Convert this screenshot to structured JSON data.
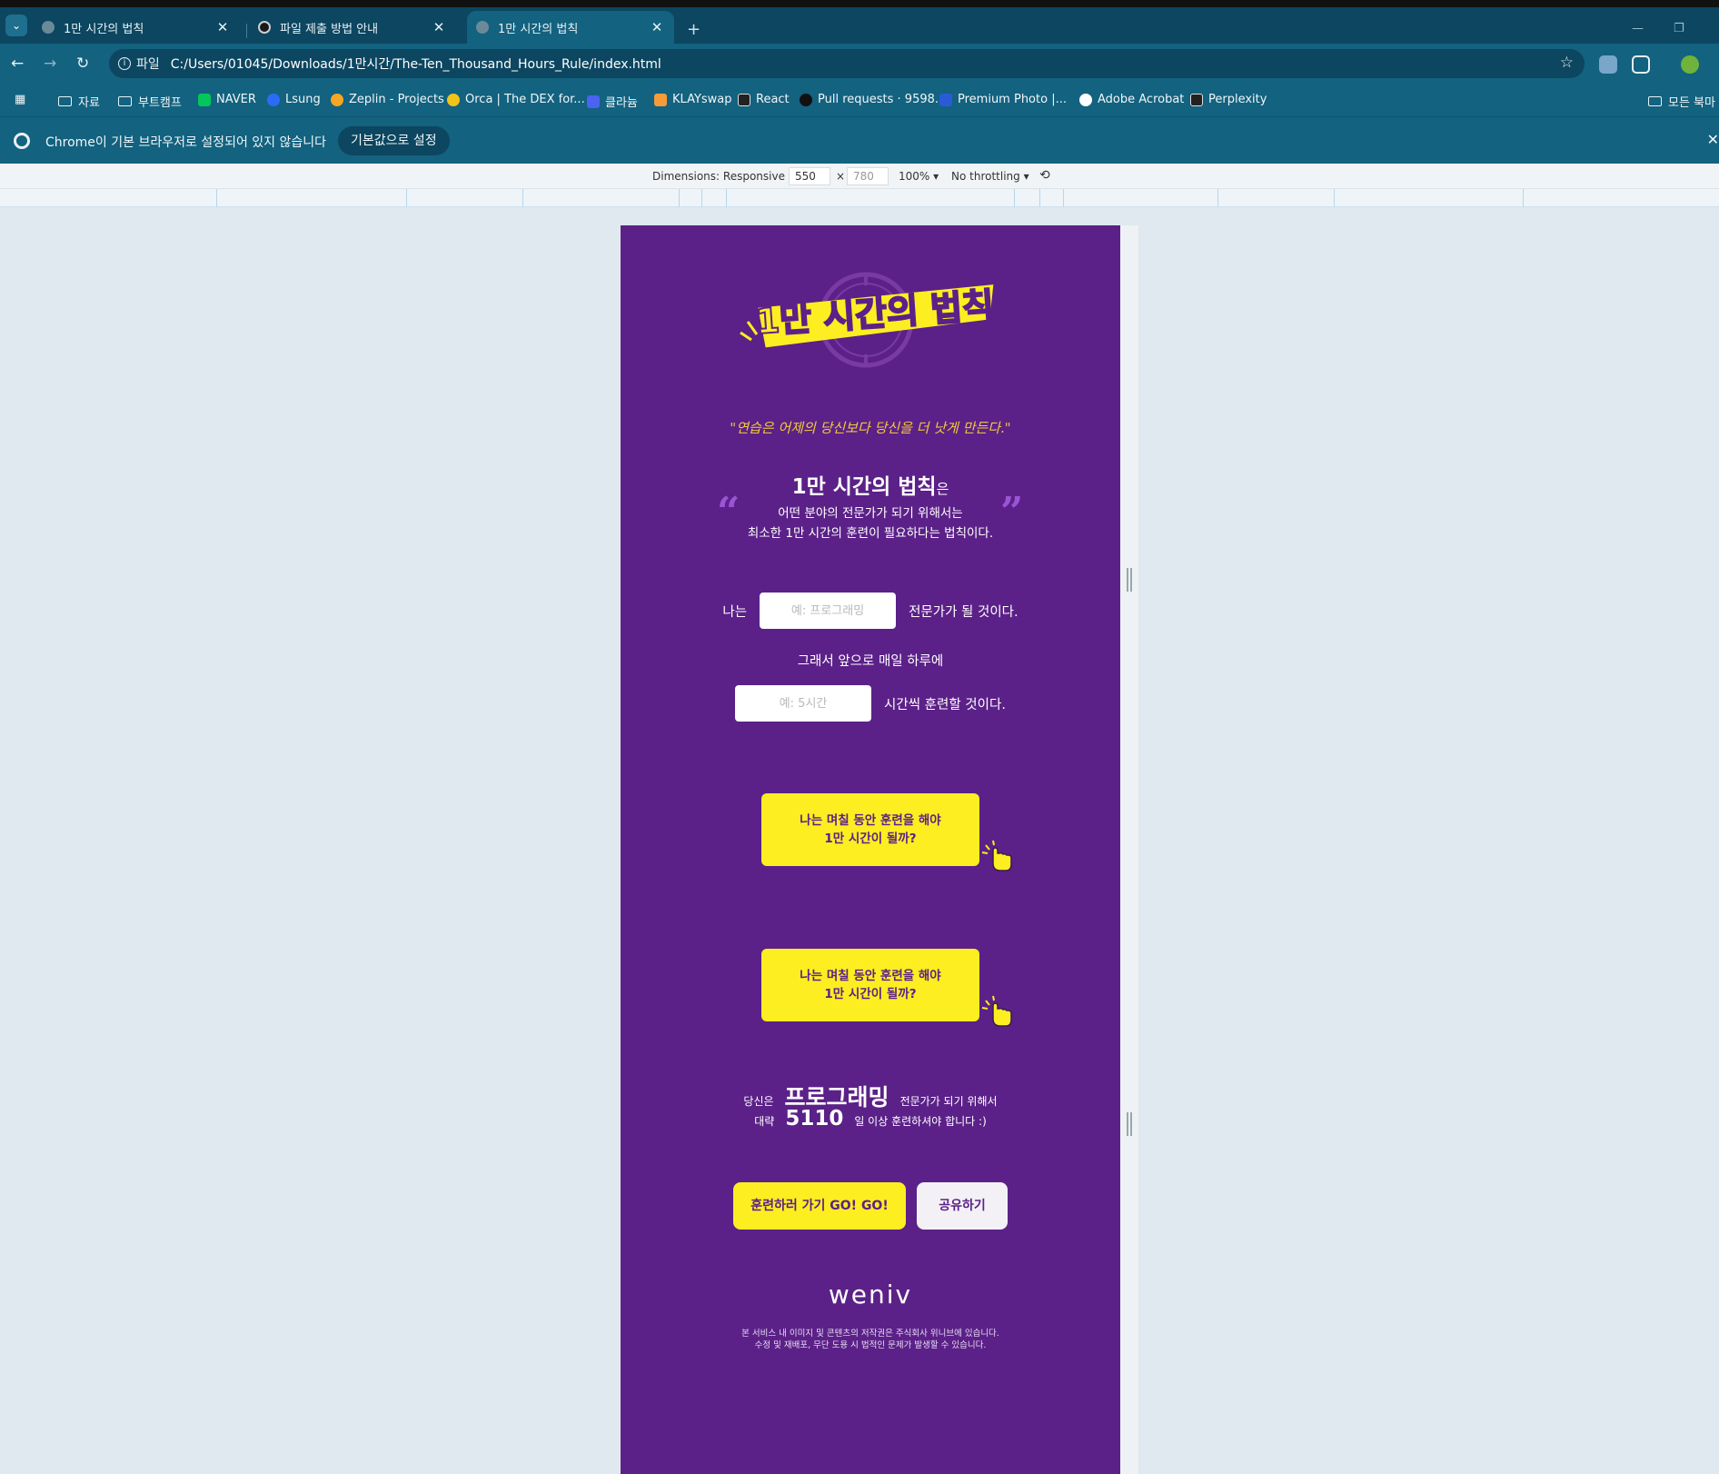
{
  "browser": {
    "tabs": [
      {
        "title": "1만 시간의 법칙",
        "active": false
      },
      {
        "title": "파일 제출 방법 안내",
        "active": false
      },
      {
        "title": "1만 시간의 법칙",
        "active": true
      }
    ],
    "address": {
      "scheme_chip": "파일",
      "url": "C:/Users/01045/Downloads/1만시간/The-Ten_Thousand_Hours_Rule/index.html"
    },
    "bookmarks": [
      {
        "label": "자료",
        "type": "folder"
      },
      {
        "label": "부트캠프",
        "type": "folder"
      },
      {
        "label": "NAVER",
        "type": "site",
        "color": "#03c75a"
      },
      {
        "label": "Lsung",
        "type": "site",
        "color": "#2b6cf6"
      },
      {
        "label": "Zeplin - Projects",
        "type": "site",
        "color": "#f6a623"
      },
      {
        "label": "Orca | The DEX for...",
        "type": "site",
        "color": "#f0c419"
      },
      {
        "label": "클라늄",
        "type": "site",
        "color": "#4a63f0"
      },
      {
        "label": "KLAYswap",
        "type": "site",
        "color": "#f59b3a"
      },
      {
        "label": "React",
        "type": "site",
        "color": "#222222"
      },
      {
        "label": "Pull requests · 9598...",
        "type": "site",
        "color": "#111111"
      },
      {
        "label": "Premium Photo |...",
        "type": "site",
        "color": "#2a5bd7"
      },
      {
        "label": "Adobe Acrobat",
        "type": "site",
        "color": "#ffffff"
      },
      {
        "label": "Perplexity",
        "type": "site",
        "color": "#222222"
      }
    ],
    "all_bookmarks": "모든 북마",
    "infobar": {
      "message": "Chrome이 기본 브라우저로 설정되어 있지 않습니다",
      "button": "기본값으로 설정"
    },
    "devtools": {
      "dimensions_label": "Dimensions: Responsive",
      "width": "550",
      "height_placeholder": "780",
      "times": "×",
      "zoom": "100%",
      "throttling": "No throttling"
    }
  },
  "page": {
    "quote": "\"연습은 어제의 당신보다 당신을 더 낫게 만든다.\"",
    "intro": {
      "title": "1만 시간의 법칙",
      "title_suffix": "은",
      "line1": "어떤 분야의 전문가가 되기 위해서는",
      "line2": "최소한 1만 시간의 훈련이 필요하다는 법칙이다."
    },
    "form": {
      "prefix": "나는",
      "field_placeholder": "예: 프로그래밍",
      "field_suffix": "전문가가 될 것이다.",
      "middle": "그래서 앞으로 매일 하루에",
      "time_placeholder": "예: 5시간",
      "time_suffix": "시간씩 훈련할 것이다."
    },
    "cta_label": "나는 며칠 동안 훈련을 해야\n1만 시간이 될까?",
    "result": {
      "you": "당신은",
      "field": "프로그래밍",
      "field_tail": "전문가가 되기 위해서",
      "approx": "대략",
      "days": "5110",
      "days_tail": "일 이상 훈련하셔야 합니다 :)"
    },
    "buttons": {
      "go": "훈련하러 가기 GO! GO!",
      "share": "공유하기"
    },
    "footer": {
      "brand": "weniv",
      "line1": "본 서비스 내 이미지 및 콘텐츠의 저작권은 주식회사 위니브에 있습니다.",
      "line2": "수정 및 재배포, 무단 도용 시 법적인 문제가 발생할 수 있습니다."
    },
    "colors": {
      "background": "#5b2188",
      "accent": "#fcee21",
      "quote": "#f3c93a"
    }
  }
}
